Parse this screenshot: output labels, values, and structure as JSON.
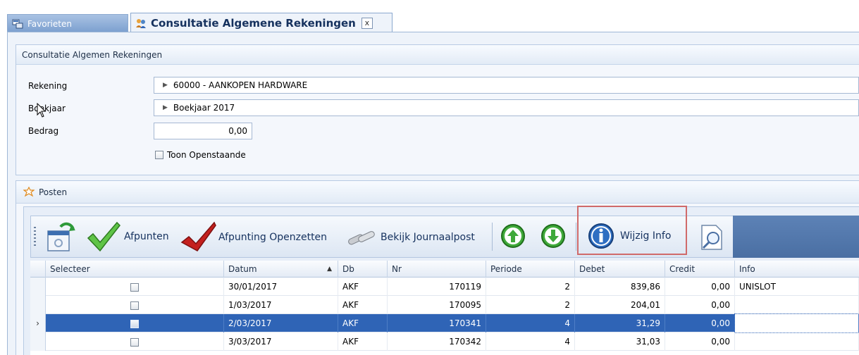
{
  "tabs": {
    "favorites_label": "Favorieten",
    "active_label": "Consultatie Algemene Rekeningen",
    "close_label": "x"
  },
  "criteria": {
    "header": "Consultatie Algemen Rekeningen",
    "rekening_label": "Rekening",
    "rekening_value": "60000 - AANKOPEN HARDWARE",
    "boekjaar_label": "Boekjaar",
    "boekjaar_value": "Boekjaar 2017",
    "bedrag_label": "Bedrag",
    "bedrag_value": "0,00",
    "toon_label": "Toon Openstaande"
  },
  "posten": {
    "header": "Posten"
  },
  "toolbar": {
    "afpunten": "Afpunten",
    "afpunting_openzetten": "Afpunting Openzetten",
    "bekijk_journaalpost": "Bekijk Journaalpost",
    "wijzig_info": "Wijzig Info"
  },
  "grid": {
    "columns": [
      "Selecteer",
      "Datum",
      "Db",
      "Nr",
      "Periode",
      "Debet",
      "Credit",
      "Info"
    ],
    "sort_indicator": "▲",
    "rows": [
      {
        "datum": "30/01/2017",
        "db": "AKF",
        "nr": "170119",
        "periode": "2",
        "debet": "839,86",
        "credit": "0,00",
        "info": "UNISLOT",
        "selected": false
      },
      {
        "datum": "1/03/2017",
        "db": "AKF",
        "nr": "170095",
        "periode": "2",
        "debet": "204,01",
        "credit": "0,00",
        "info": "",
        "selected": false
      },
      {
        "datum": "2/03/2017",
        "db": "AKF",
        "nr": "170341",
        "periode": "4",
        "debet": "31,29",
        "credit": "0,00",
        "info": "",
        "selected": true
      },
      {
        "datum": "3/03/2017",
        "db": "AKF",
        "nr": "170342",
        "periode": "4",
        "debet": "31,03",
        "credit": "0,00",
        "info": "",
        "selected": false
      }
    ]
  },
  "colors": {
    "selected_row": "#2f64b6",
    "highlight_box": "#d06a6a",
    "accent": "#15315e"
  },
  "icons": [
    "favorites-icon",
    "consultation-icon",
    "close-icon",
    "posten-icon",
    "refresh-settings-icon",
    "checkmark-icon",
    "red-checkmark-icon",
    "pipes-icon",
    "arrow-up-icon",
    "arrow-down-icon",
    "info-icon",
    "search-page-icon"
  ]
}
